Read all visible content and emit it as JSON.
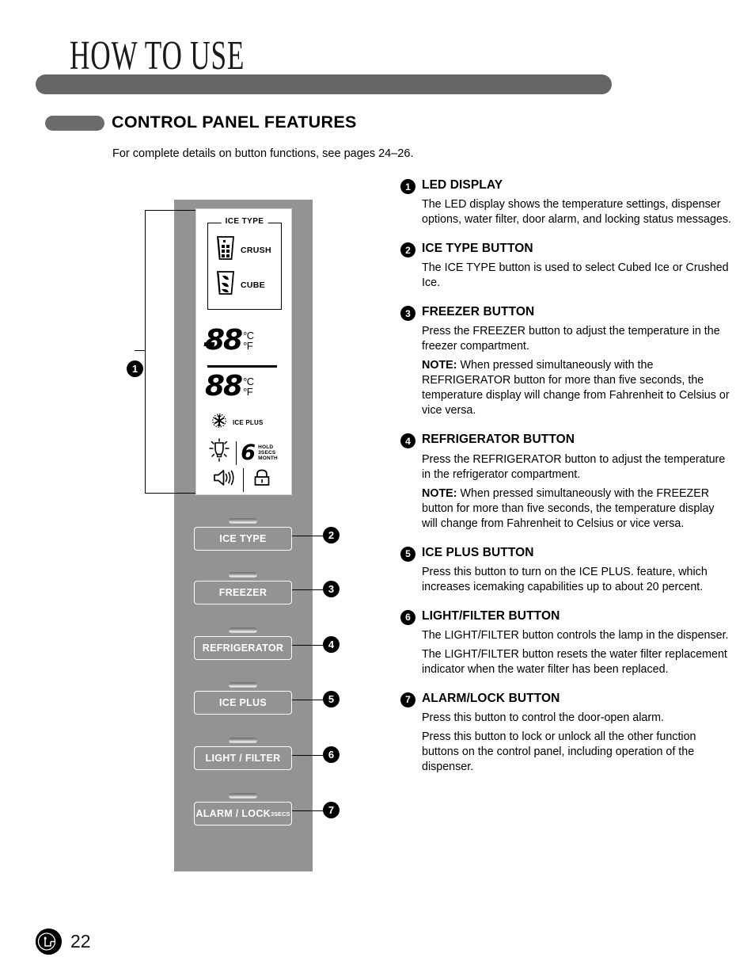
{
  "header": {
    "title": "HOW TO USE"
  },
  "section": {
    "title": "CONTROL PANEL FEATURES",
    "intro": "For complete details on button functions, see pages 24–26."
  },
  "control_panel": {
    "led_display": {
      "ice_type_label": "ICE TYPE",
      "crush_label": "CRUSH",
      "cube_label": "CUBE",
      "temp_top": {
        "digits": "88",
        "minus": "-",
        "celsius": "°C",
        "fahrenheit": "°F"
      },
      "temp_bottom": {
        "digits": "88",
        "celsius": "°C",
        "fahrenheit": "°F"
      },
      "ice_plus_label": "ICE PLUS",
      "filter": {
        "digit": "6",
        "hold": "HOLD",
        "secs": "3SECS",
        "month": "MONTH"
      }
    },
    "buttons": [
      {
        "label": "ICE TYPE",
        "callout": "2"
      },
      {
        "label": "FREEZER",
        "callout": "3"
      },
      {
        "label": "REFRIGERATOR",
        "callout": "4"
      },
      {
        "label": "ICE PLUS",
        "callout": "5"
      },
      {
        "label": "LIGHT / FILTER",
        "callout": "6"
      },
      {
        "label": "ALARM / LOCK",
        "sublabel": "3SECS",
        "callout": "7"
      }
    ],
    "display_callout": "1"
  },
  "features": [
    {
      "num": "1",
      "title": "LED DISPLAY",
      "paragraphs": [
        {
          "text": "The LED display shows the temperature settings, dispenser options, water filter, door alarm, and locking status messages."
        }
      ]
    },
    {
      "num": "2",
      "title": "ICE TYPE BUTTON",
      "paragraphs": [
        {
          "text": "The ICE TYPE button is used to select Cubed Ice or Crushed Ice."
        }
      ]
    },
    {
      "num": "3",
      "title": "FREEZER BUTTON",
      "paragraphs": [
        {
          "text": "Press the FREEZER button to adjust the temperature in the freezer compartment."
        },
        {
          "note": "NOTE:",
          "text": " When pressed simultaneously with the REFRIGERATOR button for more than five seconds, the temperature display will change from Fahrenheit to Celsius or vice versa."
        }
      ]
    },
    {
      "num": "4",
      "title": "REFRIGERATOR BUTTON",
      "paragraphs": [
        {
          "text": "Press the REFRIGERATOR button to adjust the temperature in the refrigerator compartment."
        },
        {
          "note": "NOTE:",
          "text": " When pressed simultaneously with the FREEZER button for more than five seconds, the temperature display will change from Fahrenheit to Celsius or vice versa."
        }
      ]
    },
    {
      "num": "5",
      "title": "ICE PLUS BUTTON",
      "paragraphs": [
        {
          "text": "Press this button to turn on the ICE PLUS. feature, which increases icemaking capabilities up to about 20 percent."
        }
      ]
    },
    {
      "num": "6",
      "title": "LIGHT/FILTER BUTTON",
      "paragraphs": [
        {
          "text": "The LIGHT/FILTER button controls the lamp in the dispenser."
        },
        {
          "text": "The LIGHT/FILTER button resets the water filter replacement indicator when the water filter has been replaced."
        }
      ]
    },
    {
      "num": "7",
      "title": "ALARM/LOCK BUTTON",
      "paragraphs": [
        {
          "text": "Press this button to control the door-open alarm."
        },
        {
          "text": "Press this button to lock or unlock all the other function buttons on the control panel, including operation of the dispenser."
        }
      ]
    }
  ],
  "footer": {
    "brand": "LG",
    "page_number": "22"
  },
  "colors": {
    "header_bar": "#656565",
    "section_pill": "#6b6b6b",
    "panel_gray": "#939393",
    "display_white": "#ffffff",
    "text_black": "#000000"
  }
}
